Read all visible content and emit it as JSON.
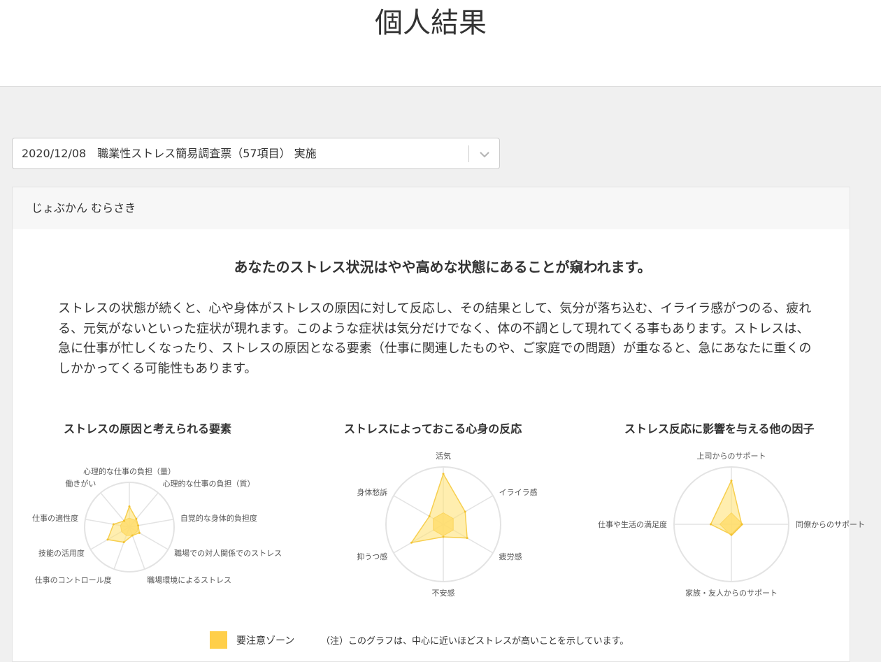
{
  "page": {
    "title": "個人結果"
  },
  "survey_select": {
    "value": "2020/12/08　職業性ストレス簡易調査票（57項目） 実施"
  },
  "result": {
    "user_name": "じょぶかん むらさき",
    "headline": "あなたのストレス状況はやや高めな状態にあることが窺われます。",
    "description": "ストレスの状態が続くと、心や身体がストレスの原因に対して反応し、その結果として、気分が落ち込む、イライラ感がつのる、疲れる、元気がないといった症状が現れます。このような症状は気分だけでなく、体の不調として現れてくる事もあります。ストレスは、急に仕事が忙しくなったり、ストレスの原因となる要素（仕事に関連したものや、ご家庭での問題）が重なると、急にあなたに重くのしかかってくる可能性もあります。"
  },
  "legend": {
    "zone_label": "要注意ゾーン",
    "note": "（注）このグラフは、中心に近いほどストレスが高いことを示しています。",
    "zone_color": "#ffcf4a"
  },
  "chart_data": [
    {
      "type": "radar",
      "title": "ストレスの原因と考えられる要素",
      "axes": [
        "心理的な仕事の負担（量）",
        "心理的な仕事の負担（質）",
        "自覚的な身体的負担度",
        "職場での対人関係でのストレス",
        "職場環境によるストレス",
        "仕事のコントロール度",
        "技能の活用度",
        "仕事の適性度",
        "働きがい"
      ],
      "range": [
        0,
        5
      ],
      "values": [
        2.3,
        1.2,
        1.0,
        1.3,
        1.0,
        1.8,
        2.8,
        1.8,
        0.9
      ],
      "caution_zone": [
        1,
        1,
        1,
        1,
        1,
        1,
        1,
        1,
        1
      ]
    },
    {
      "type": "radar",
      "title": "ストレスによっておこる心身の反応",
      "axes": [
        "活気",
        "イライラ感",
        "疲労感",
        "不安感",
        "抑うつ感",
        "身体愁訴"
      ],
      "range": [
        0,
        5
      ],
      "values": [
        4.4,
        2.2,
        2.4,
        1.1,
        3.2,
        1.4
      ],
      "caution_zone": [
        1,
        1,
        1,
        1,
        1,
        1
      ]
    },
    {
      "type": "radar",
      "title": "ストレス反応に影響を与える他の因子",
      "axes": [
        "上司からのサポート",
        "同僚からのサポート",
        "家族・友人からのサポート",
        "仕事や生活の満足度"
      ],
      "range": [
        0,
        5
      ],
      "values": [
        3.8,
        0.9,
        0.9,
        1.8
      ],
      "caution_zone": [
        1,
        1,
        1,
        1
      ]
    }
  ]
}
